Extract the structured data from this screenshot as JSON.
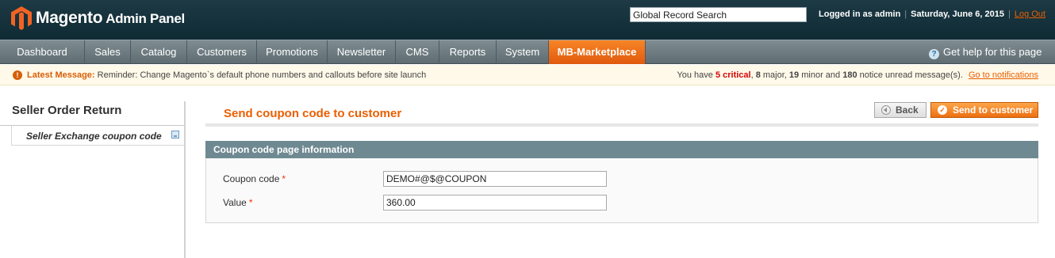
{
  "header": {
    "brand": "Magento",
    "brand_sub": "Admin Panel",
    "global_search_value": "Global Record Search",
    "logged_in": "Logged in as admin",
    "date": "Saturday, June 6, 2015",
    "logout": "Log Out"
  },
  "nav": {
    "items": [
      "Dashboard",
      "Sales",
      "Catalog",
      "Customers",
      "Promotions",
      "Newsletter",
      "CMS",
      "Reports",
      "System",
      "MB-Marketplace"
    ],
    "active": "MB-Marketplace",
    "help": "Get help for this page"
  },
  "message": {
    "label": "Latest Message:",
    "text": "Reminder: Change Magento`s default phone numbers and callouts before site launch",
    "right_prefix": "You have",
    "critical": "5 critical",
    "major": "8",
    "major_suffix": "major,",
    "minor": "19",
    "minor_suffix": "minor and",
    "notice": "180",
    "notice_suffix": "notice unread message(s).",
    "link": "Go to notifications"
  },
  "sidebar": {
    "title": "Seller Order Return",
    "items": [
      {
        "label": "Seller Exchange coupon code"
      }
    ]
  },
  "main": {
    "title": "Send coupon code to customer",
    "back_label": "Back",
    "send_label": "Send to customer",
    "fieldset_title": "Coupon code page information",
    "fields": [
      {
        "label": "Coupon code",
        "required": "*",
        "value": "DEMO#@$@COUPON"
      },
      {
        "label": "Value",
        "required": "*",
        "value": "360.00"
      }
    ]
  },
  "colors": {
    "accent": "#eb5e00",
    "header_bg": "#1d3a45",
    "nav_bg": "#6f7d82",
    "fieldset_head": "#6f8992"
  }
}
